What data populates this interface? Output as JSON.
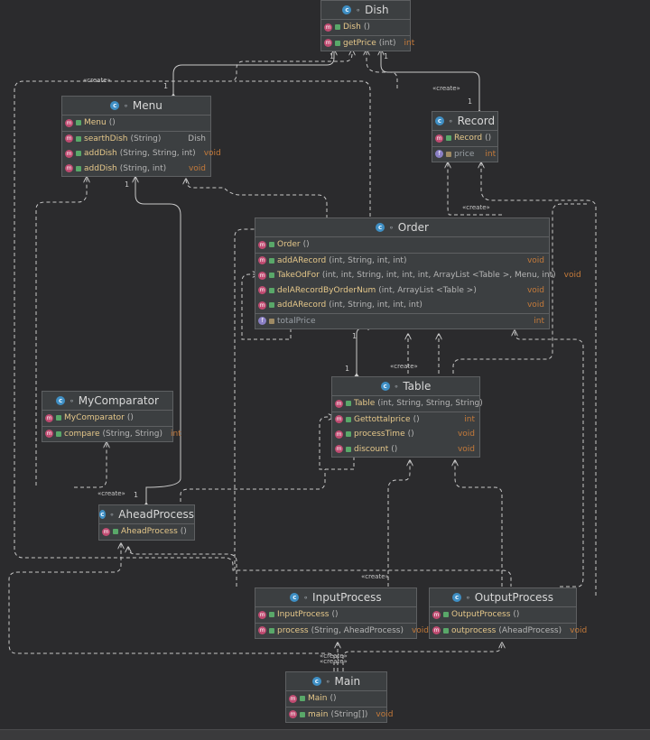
{
  "classes": {
    "dish": {
      "name": "Dish",
      "rows": [
        {
          "kind": "method",
          "name": "Dish",
          "params": "()",
          "type": ""
        },
        {
          "kind": "method",
          "name": "getPrice",
          "params": "(int)",
          "type": "int",
          "sep": true
        }
      ]
    },
    "menu": {
      "name": "Menu",
      "rows": [
        {
          "kind": "method",
          "name": "Menu",
          "params": "()",
          "type": ""
        },
        {
          "kind": "method",
          "name": "searthDish",
          "params": "(String)",
          "type": "Dish",
          "sep": true
        },
        {
          "kind": "method",
          "name": "addDish",
          "params": "(String, String, int)",
          "type": "void"
        },
        {
          "kind": "method",
          "name": "addDish",
          "params": "(String, int)",
          "type": "void"
        }
      ]
    },
    "record": {
      "name": "Record",
      "rows": [
        {
          "kind": "method",
          "name": "Record",
          "params": "()",
          "type": ""
        },
        {
          "kind": "field",
          "name": "price",
          "params": "",
          "type": "int",
          "sep": true
        }
      ]
    },
    "order": {
      "name": "Order",
      "rows": [
        {
          "kind": "method",
          "name": "Order",
          "params": "()",
          "type": ""
        },
        {
          "kind": "method",
          "name": "addARecord",
          "params": "(int, String, int, int)",
          "type": "void",
          "sep": true
        },
        {
          "kind": "method",
          "name": "TakeOdFor",
          "params": "(int, int, String, int, int, int, ArrayList <Table >, Menu, int)",
          "type": "void"
        },
        {
          "kind": "method",
          "name": "delARecordByOrderNum",
          "params": "(int, ArrayList <Table >)",
          "type": "void"
        },
        {
          "kind": "method",
          "name": "addARecord",
          "params": "(int, String, int, int, int)",
          "type": "void"
        },
        {
          "kind": "field",
          "name": "totalPrice",
          "params": "",
          "type": "int",
          "sep": true
        }
      ]
    },
    "table": {
      "name": "Table",
      "rows": [
        {
          "kind": "method",
          "name": "Table",
          "params": "(int, String, String, String)",
          "type": ""
        },
        {
          "kind": "method",
          "name": "Gettottalprice",
          "params": "()",
          "type": "int",
          "sep": true
        },
        {
          "kind": "method",
          "name": "processTime",
          "params": "()",
          "type": "void"
        },
        {
          "kind": "method",
          "name": "discount",
          "params": "()",
          "type": "void"
        }
      ]
    },
    "mycomparator": {
      "name": "MyComparator",
      "rows": [
        {
          "kind": "method",
          "name": "MyComparator",
          "params": "()",
          "type": ""
        },
        {
          "kind": "method",
          "name": "compare",
          "params": "(String, String)",
          "type": "int",
          "sep": true
        }
      ]
    },
    "aheadprocess": {
      "name": "AheadProcess",
      "rows": [
        {
          "kind": "method",
          "name": "AheadProcess",
          "params": "()",
          "type": ""
        }
      ]
    },
    "inputprocess": {
      "name": "InputProcess",
      "rows": [
        {
          "kind": "method",
          "name": "InputProcess",
          "params": "()",
          "type": ""
        },
        {
          "kind": "method",
          "name": "process",
          "params": "(String, AheadProcess)",
          "type": "void",
          "sep": true
        }
      ]
    },
    "outputprocess": {
      "name": "OutputProcess",
      "rows": [
        {
          "kind": "method",
          "name": "OutputProcess",
          "params": "()",
          "type": ""
        },
        {
          "kind": "method",
          "name": "outprocess",
          "params": "(AheadProcess)",
          "type": "void",
          "sep": true
        }
      ]
    },
    "main": {
      "name": "Main",
      "rows": [
        {
          "kind": "method",
          "name": "Main",
          "params": "()",
          "type": ""
        },
        {
          "kind": "method",
          "name": "main",
          "params": "(String[])",
          "type": "void",
          "sep": true
        }
      ]
    }
  },
  "labels": {
    "create": "«create»",
    "one": "1",
    "class_badge": "c",
    "method_badge": "m",
    "field_badge": "f",
    "public_marker": "⚬"
  },
  "colors": {
    "background": "#2b2b2d",
    "box": "#3c3f41",
    "line": "#c8c8c8",
    "method_badge": "#c04b71",
    "class_badge": "#3f8fc4",
    "return_type": "#c47a3a"
  }
}
